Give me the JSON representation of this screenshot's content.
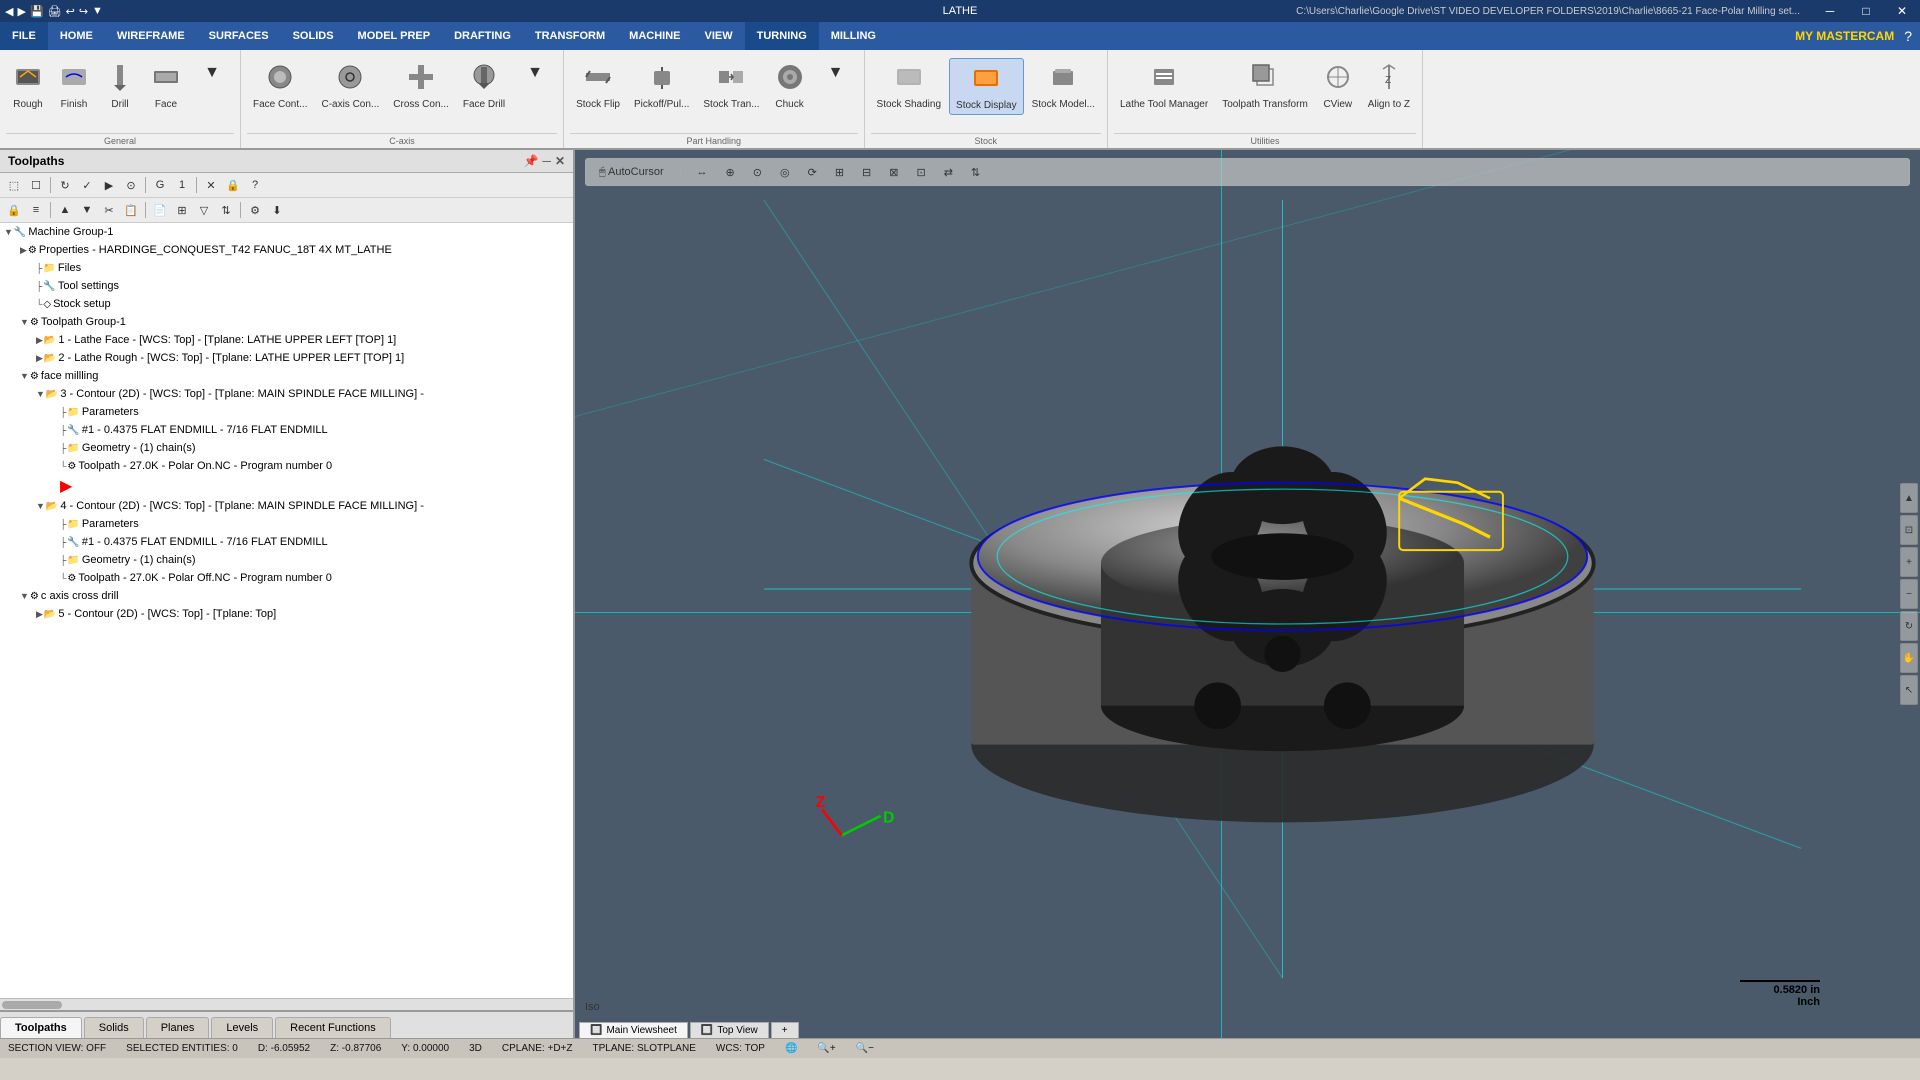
{
  "app": {
    "title": "LATHE",
    "window_path": "C:\\Users\\Charlie\\Google Drive\\ST VIDEO DEVELOPER FOLDERS\\2019\\Charlie\\8665-21 Face-Polar Milling set...",
    "brand": "MY MASTERCAM"
  },
  "titlebar": {
    "quick_icons": [
      "◀",
      "▶",
      "💾",
      "🖨",
      "✂",
      "📋",
      "↩",
      "↪",
      "▼"
    ],
    "win_controls": [
      "─",
      "□",
      "✕"
    ]
  },
  "menubar": {
    "items": [
      "FILE",
      "HOME",
      "WIREFRAME",
      "SURFACES",
      "SOLIDS",
      "MODEL PREP",
      "DRAFTING",
      "TRANSFORM",
      "MACHINE",
      "VIEW",
      "TURNING",
      "MILLING"
    ],
    "active_index": 10
  },
  "ribbon": {
    "sections": [
      {
        "label": "General",
        "buttons": [
          {
            "icon": "⬛",
            "label": "Rough",
            "active": false
          },
          {
            "icon": "▭",
            "label": "Finish",
            "active": false
          },
          {
            "icon": "⊕",
            "label": "Drill",
            "active": false
          },
          {
            "icon": "◱",
            "label": "Face",
            "active": false
          }
        ]
      },
      {
        "label": "C-axis",
        "buttons": [
          {
            "icon": "◉",
            "label": "Face Cont...",
            "active": false
          },
          {
            "icon": "◎",
            "label": "C-axis Con...",
            "active": false
          },
          {
            "icon": "✚",
            "label": "Cross Con...",
            "active": false
          },
          {
            "icon": "⊛",
            "label": "Face Drill",
            "active": false
          }
        ]
      },
      {
        "label": "Part Handling",
        "buttons": [
          {
            "icon": "↔",
            "label": "Stock Flip",
            "active": false
          },
          {
            "icon": "⇕",
            "label": "Pickoff/Pul...",
            "active": false
          },
          {
            "icon": "↕",
            "label": "Stock Tran...",
            "active": false
          },
          {
            "icon": "⚙",
            "label": "Chuck",
            "active": false
          }
        ]
      },
      {
        "label": "Stock",
        "buttons": [
          {
            "icon": "🔲",
            "label": "Stock Shading",
            "active": false
          },
          {
            "icon": "🔳",
            "label": "Stock Display",
            "active": true
          },
          {
            "icon": "📦",
            "label": "Stock Model...",
            "active": false
          }
        ]
      },
      {
        "label": "Utilities",
        "buttons": [
          {
            "icon": "⚒",
            "label": "Lathe Tool Manager",
            "active": false
          },
          {
            "icon": "🔧",
            "label": "Toolpath Transform",
            "active": false
          },
          {
            "icon": "👁",
            "label": "CView",
            "active": false
          },
          {
            "icon": "⊹",
            "label": "Align to Z",
            "active": false
          }
        ]
      }
    ]
  },
  "left_panel": {
    "title": "Toolpaths",
    "panel_controls": [
      "▼",
      "─",
      "✕"
    ],
    "tree": [
      {
        "level": 0,
        "icon": "🔧",
        "text": "Machine Group-1",
        "type": "group",
        "expanded": true
      },
      {
        "level": 1,
        "icon": "⚙",
        "text": "Properties - HARDINGE_CONQUEST_T42 FANUC_18T 4X MT_LATHE",
        "type": "properties",
        "expanded": false
      },
      {
        "level": 2,
        "icon": "📁",
        "text": "Files",
        "type": "folder"
      },
      {
        "level": 2,
        "icon": "🔧",
        "text": "Tool settings",
        "type": "settings"
      },
      {
        "level": 2,
        "icon": "◇",
        "text": "Stock setup",
        "type": "stock"
      },
      {
        "level": 1,
        "icon": "⚙",
        "text": "Toolpath Group-1",
        "type": "group",
        "expanded": true
      },
      {
        "level": 2,
        "icon": "📂",
        "text": "1 - Lathe Face - [WCS: Top] - [Tplane: LATHE UPPER LEFT [TOP] 1]",
        "type": "toolpath"
      },
      {
        "level": 2,
        "icon": "📂",
        "text": "2 - Lathe Rough - [WCS: Top] - [Tplane: LATHE UPPER LEFT [TOP] 1]",
        "type": "toolpath"
      },
      {
        "level": 1,
        "icon": "⚙",
        "text": "face millling",
        "type": "group",
        "expanded": true
      },
      {
        "level": 2,
        "icon": "📂",
        "text": "3 - Contour (2D) - [WCS: Top] - [Tplane: MAIN SPINDLE FACE MILLING] -",
        "type": "toolpath",
        "expanded": true
      },
      {
        "level": 3,
        "icon": "📁",
        "text": "Parameters",
        "type": "params"
      },
      {
        "level": 3,
        "icon": "🔧",
        "text": "#1 - 0.4375 FLAT ENDMILL -  7/16 FLAT ENDMILL",
        "type": "tool"
      },
      {
        "level": 3,
        "icon": "📁",
        "text": "Geometry - (1) chain(s)",
        "type": "geometry"
      },
      {
        "level": 3,
        "icon": "⚙",
        "text": "Toolpath - 27.0K - Polar On.NC - Program number 0",
        "type": "toolpath-data"
      },
      {
        "level": 3,
        "icon": "▶",
        "text": "",
        "type": "play"
      },
      {
        "level": 2,
        "icon": "📂",
        "text": "4 - Contour (2D) - [WCS: Top] - [Tplane: MAIN SPINDLE FACE MILLING] -",
        "type": "toolpath",
        "expanded": true
      },
      {
        "level": 3,
        "icon": "📁",
        "text": "Parameters",
        "type": "params"
      },
      {
        "level": 3,
        "icon": "🔧",
        "text": "#1 - 0.4375 FLAT ENDMILL -  7/16 FLAT ENDMILL",
        "type": "tool"
      },
      {
        "level": 3,
        "icon": "📁",
        "text": "Geometry - (1) chain(s)",
        "type": "geometry"
      },
      {
        "level": 3,
        "icon": "⚙",
        "text": "Toolpath - 27.0K - Polar Off.NC - Program number 0",
        "type": "toolpath-data"
      },
      {
        "level": 1,
        "icon": "⚙",
        "text": "c axis cross drill",
        "type": "group",
        "expanded": true
      },
      {
        "level": 2,
        "icon": "📂",
        "text": "5 - Contour (2D) - [WCS: Top] - [Tplane: Top]",
        "type": "toolpath"
      }
    ],
    "bottom_tabs": [
      "Toolpaths",
      "Solids",
      "Planes",
      "Levels",
      "Recent Functions"
    ]
  },
  "viewport": {
    "view_label": "Iso",
    "viewsheet_tabs": [
      "Main Viewsheet",
      "Top View"
    ],
    "scale_label": "0.5820 in",
    "scale_unit": "Inch",
    "nav_buttons": [
      "+",
      "−",
      "◀",
      "▶"
    ]
  },
  "status_bar": {
    "section_view": "SECTION VIEW: OFF",
    "selected": "SELECTED ENTITIES: 0",
    "d_coord": "D: -6.05952",
    "z_coord": "Z: -0.87706",
    "y_coord": "Y: 0.00000",
    "mode": "3D",
    "cplane": "CPLANE: +D+Z",
    "tplane": "TPLANE: SLOTPLANE",
    "wcs": "WCS: TOP",
    "globe_icon": "🌐",
    "zoom_icons": [
      "🔍",
      "🔍"
    ]
  }
}
